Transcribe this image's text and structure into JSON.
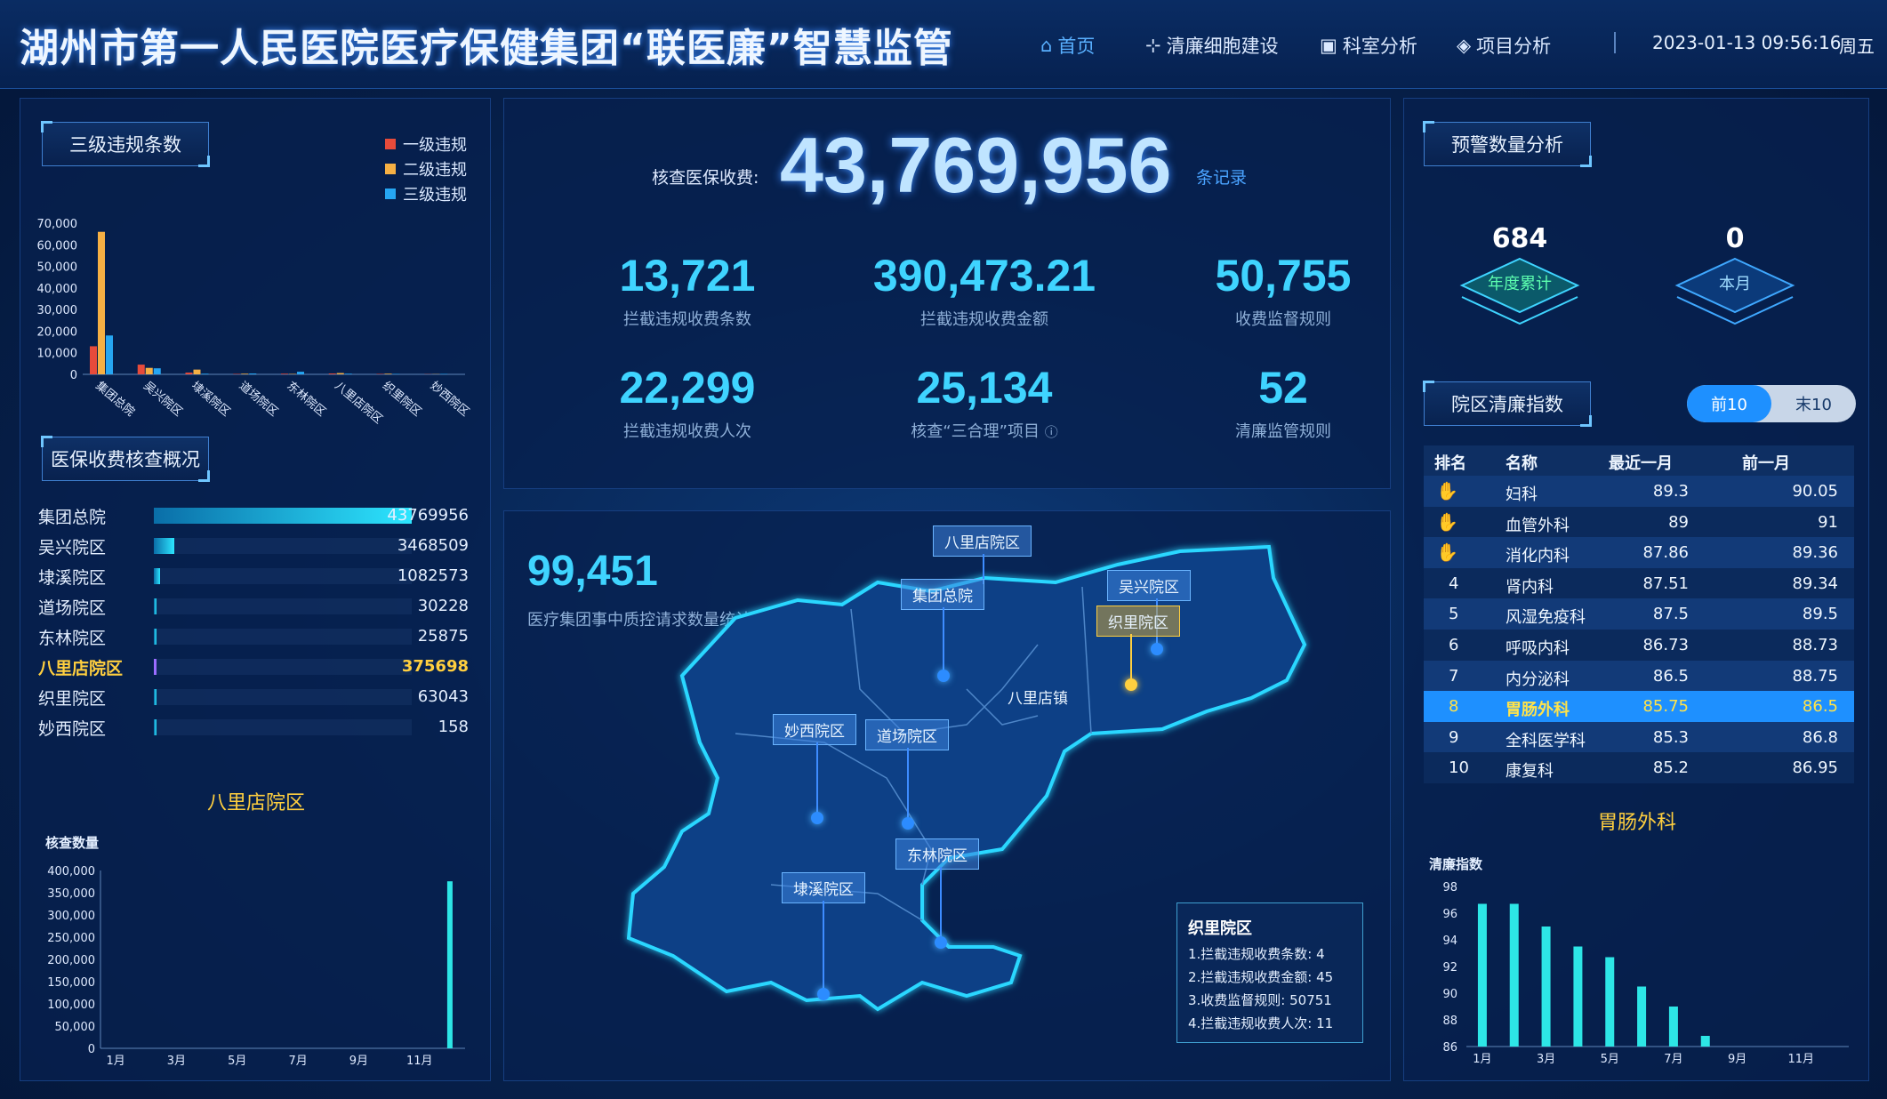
{
  "header": {
    "title": "湖州市第一人民医院医疗保健集团“联医廉”智慧监管",
    "nav": [
      {
        "label": "首页",
        "icon": "home-icon",
        "active": true
      },
      {
        "label": "清廉细胞建设",
        "icon": "network-icon",
        "active": false
      },
      {
        "label": "科室分析",
        "icon": "monitor-icon",
        "active": false
      },
      {
        "label": "项目分析",
        "icon": "layers-icon",
        "active": false
      }
    ],
    "datetime": "2023-01-13 09:56:16",
    "weekday": "周五"
  },
  "colors": {
    "accent": "#3fd4ff",
    "level1": "#e64b3b",
    "level2": "#f6b044",
    "level3": "#26a6f2",
    "highlight": "#ffcf3f",
    "selected_row": "#1e90ff"
  },
  "violations": {
    "title": "三级违规条数",
    "legend": [
      "一级违规",
      "二级违规",
      "三级违规"
    ]
  },
  "insurance": {
    "title": "医保收费核查概况",
    "rows": [
      {
        "name": "集团总院",
        "value": "43769956",
        "share": 1.0,
        "highlight": false
      },
      {
        "name": "吴兴院区",
        "value": "3468509",
        "share": 0.08,
        "highlight": false
      },
      {
        "name": "埭溪院区",
        "value": "1082573",
        "share": 0.025,
        "highlight": false
      },
      {
        "name": "道场院区",
        "value": "30228",
        "share": 0.001,
        "highlight": false
      },
      {
        "name": "东林院区",
        "value": "25875",
        "share": 0.001,
        "highlight": false
      },
      {
        "name": "八里店院区",
        "value": "375698",
        "share": 0.009,
        "highlight": true
      },
      {
        "name": "织里院区",
        "value": "63043",
        "share": 0.0015,
        "highlight": false
      },
      {
        "name": "妙西院区",
        "value": "158",
        "share": 0.0001,
        "highlight": false
      }
    ]
  },
  "center": {
    "label": "核查医保收费:",
    "total": "43,769,956",
    "unit": "条记录",
    "stats": [
      {
        "num": "13,721",
        "label": "拦截违规收费条数"
      },
      {
        "num": "390,473.21",
        "label": "拦截违规收费金额"
      },
      {
        "num": "50,755",
        "label": "收费监督规则"
      },
      {
        "num": "22,299",
        "label": "拦截违规收费人次"
      },
      {
        "num": "25,134",
        "label": "核查“三合理”项目"
      },
      {
        "num": "52",
        "label": "清廉监管规则"
      }
    ]
  },
  "map": {
    "count": "99,451",
    "count_label": "医疗集团事中质控请求数量统计",
    "town_label": "八里店镇",
    "tags": [
      {
        "label": "八里店院区"
      },
      {
        "label": "集团总院"
      },
      {
        "label": "吴兴院区"
      },
      {
        "label": "织里院区"
      },
      {
        "label": "妙西院区"
      },
      {
        "label": "道场院区"
      },
      {
        "label": "东林院区"
      },
      {
        "label": "埭溪院区"
      }
    ],
    "info": {
      "title": "织里院区",
      "lines": [
        "1.拦截违规收费条数:  4",
        "2.拦截违规收费金额:  45",
        "3.收费监督规则:  50751",
        "4.拦截违规收费人次:  11"
      ]
    }
  },
  "warning": {
    "title": "预警数量分析",
    "items": [
      {
        "value": "684",
        "label": "年度累计"
      },
      {
        "value": "0",
        "label": "本月"
      }
    ]
  },
  "integrity": {
    "title": "院区清廉指数",
    "toggle": [
      "前10",
      "末10"
    ],
    "columns": [
      "排名",
      "名称",
      "最近一月",
      "前一月"
    ],
    "rows": [
      {
        "rank": "",
        "medal": "gold",
        "name": "妇科",
        "recent": "89.3",
        "prev": "90.05"
      },
      {
        "rank": "",
        "medal": "silver",
        "name": "血管外科",
        "recent": "89",
        "prev": "91"
      },
      {
        "rank": "",
        "medal": "bronze",
        "name": "消化内科",
        "recent": "87.86",
        "prev": "89.36"
      },
      {
        "rank": "4",
        "name": "肾内科",
        "recent": "87.51",
        "prev": "89.34"
      },
      {
        "rank": "5",
        "name": "风湿免疫科",
        "recent": "87.5",
        "prev": "89.5"
      },
      {
        "rank": "6",
        "name": "呼吸内科",
        "recent": "86.73",
        "prev": "88.73"
      },
      {
        "rank": "7",
        "name": "内分泌科",
        "recent": "86.5",
        "prev": "88.75"
      },
      {
        "rank": "8",
        "name": "胃肠外科",
        "recent": "85.75",
        "prev": "86.5",
        "selected": true
      },
      {
        "rank": "9",
        "name": "全科医学科",
        "recent": "85.3",
        "prev": "86.8"
      },
      {
        "rank": "10",
        "name": "康复科",
        "recent": "85.2",
        "prev": "86.95"
      }
    ]
  },
  "chart_data": [
    {
      "id": "violations",
      "type": "bar",
      "categories": [
        "集团总院",
        "吴兴院区",
        "埭溪院区",
        "道场院区",
        "东林院区",
        "八里店院区",
        "织里院区",
        "妙西院区"
      ],
      "series": [
        {
          "name": "一级违规",
          "values": [
            13000,
            4500,
            800,
            200,
            300,
            400,
            200,
            100
          ]
        },
        {
          "name": "二级违规",
          "values": [
            66000,
            3000,
            2200,
            300,
            200,
            600,
            300,
            100
          ]
        },
        {
          "name": "三级违规",
          "values": [
            18000,
            2800,
            300,
            400,
            1200,
            300,
            200,
            200
          ]
        }
      ],
      "yticks": [
        "70,000",
        "60,000",
        "50,000",
        "40,000",
        "30,000",
        "20,000",
        "10,000",
        "0"
      ],
      "ylim": [
        0,
        70000
      ]
    },
    {
      "id": "bali",
      "type": "bar",
      "title": "八里店院区",
      "ylabel": "核查数量",
      "categories": [
        "1月",
        "2月",
        "3月",
        "4月",
        "5月",
        "6月",
        "7月",
        "8月",
        "9月",
        "10月",
        "11月",
        "12月"
      ],
      "xticks": [
        "1月",
        "3月",
        "5月",
        "7月",
        "9月",
        "11月"
      ],
      "values": [
        0,
        0,
        0,
        0,
        0,
        0,
        0,
        0,
        0,
        0,
        0,
        375698
      ],
      "yticks": [
        "400,000",
        "350,000",
        "300,000",
        "250,000",
        "200,000",
        "150,000",
        "100,000",
        "50,000",
        "0"
      ],
      "ylim": [
        0,
        400000
      ]
    },
    {
      "id": "gastro",
      "type": "bar",
      "title": "胃肠外科",
      "ylabel": "清廉指数",
      "categories": [
        "1月",
        "2月",
        "3月",
        "4月",
        "5月",
        "6月",
        "7月",
        "8月",
        "9月",
        "10月",
        "11月",
        "12月"
      ],
      "xticks": [
        "1月",
        "3月",
        "5月",
        "7月",
        "9月",
        "11月"
      ],
      "values": [
        96.7,
        96.7,
        95,
        93.5,
        92.7,
        90.5,
        89,
        86.8,
        0,
        0,
        0,
        0
      ],
      "yticks": [
        "98",
        "96",
        "94",
        "92",
        "90",
        "88",
        "86"
      ],
      "ylim": [
        86,
        98
      ]
    }
  ]
}
